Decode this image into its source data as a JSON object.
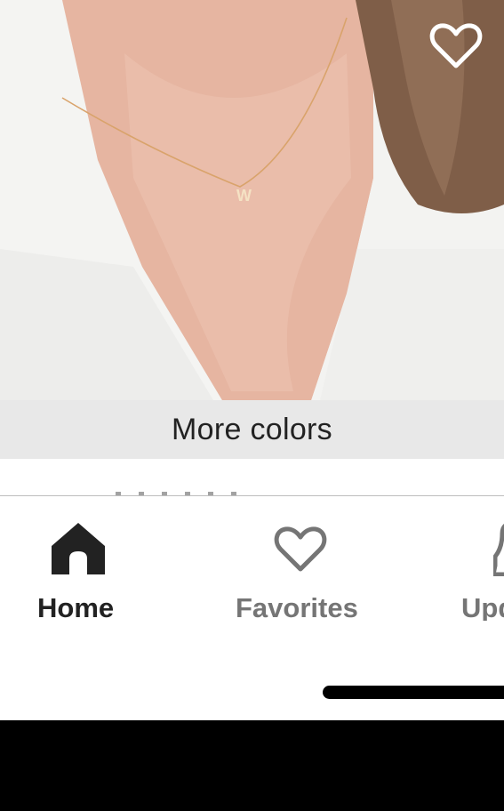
{
  "product": {
    "image_alt_icon": "necklace-photo",
    "favorite_icon": "heart-outline-icon"
  },
  "more_colors_label": "More colors",
  "tabbar": {
    "tabs": [
      {
        "label": "Home",
        "icon": "home-icon",
        "active": true
      },
      {
        "label": "Favorites",
        "icon": "heart-outline-icon",
        "active": false
      },
      {
        "label": "Upd",
        "icon": "bell-icon",
        "active": false
      }
    ]
  },
  "colors": {
    "active_tab": "#222222",
    "inactive_tab": "#757575",
    "more_colors_bg": "#e8e8e8"
  }
}
